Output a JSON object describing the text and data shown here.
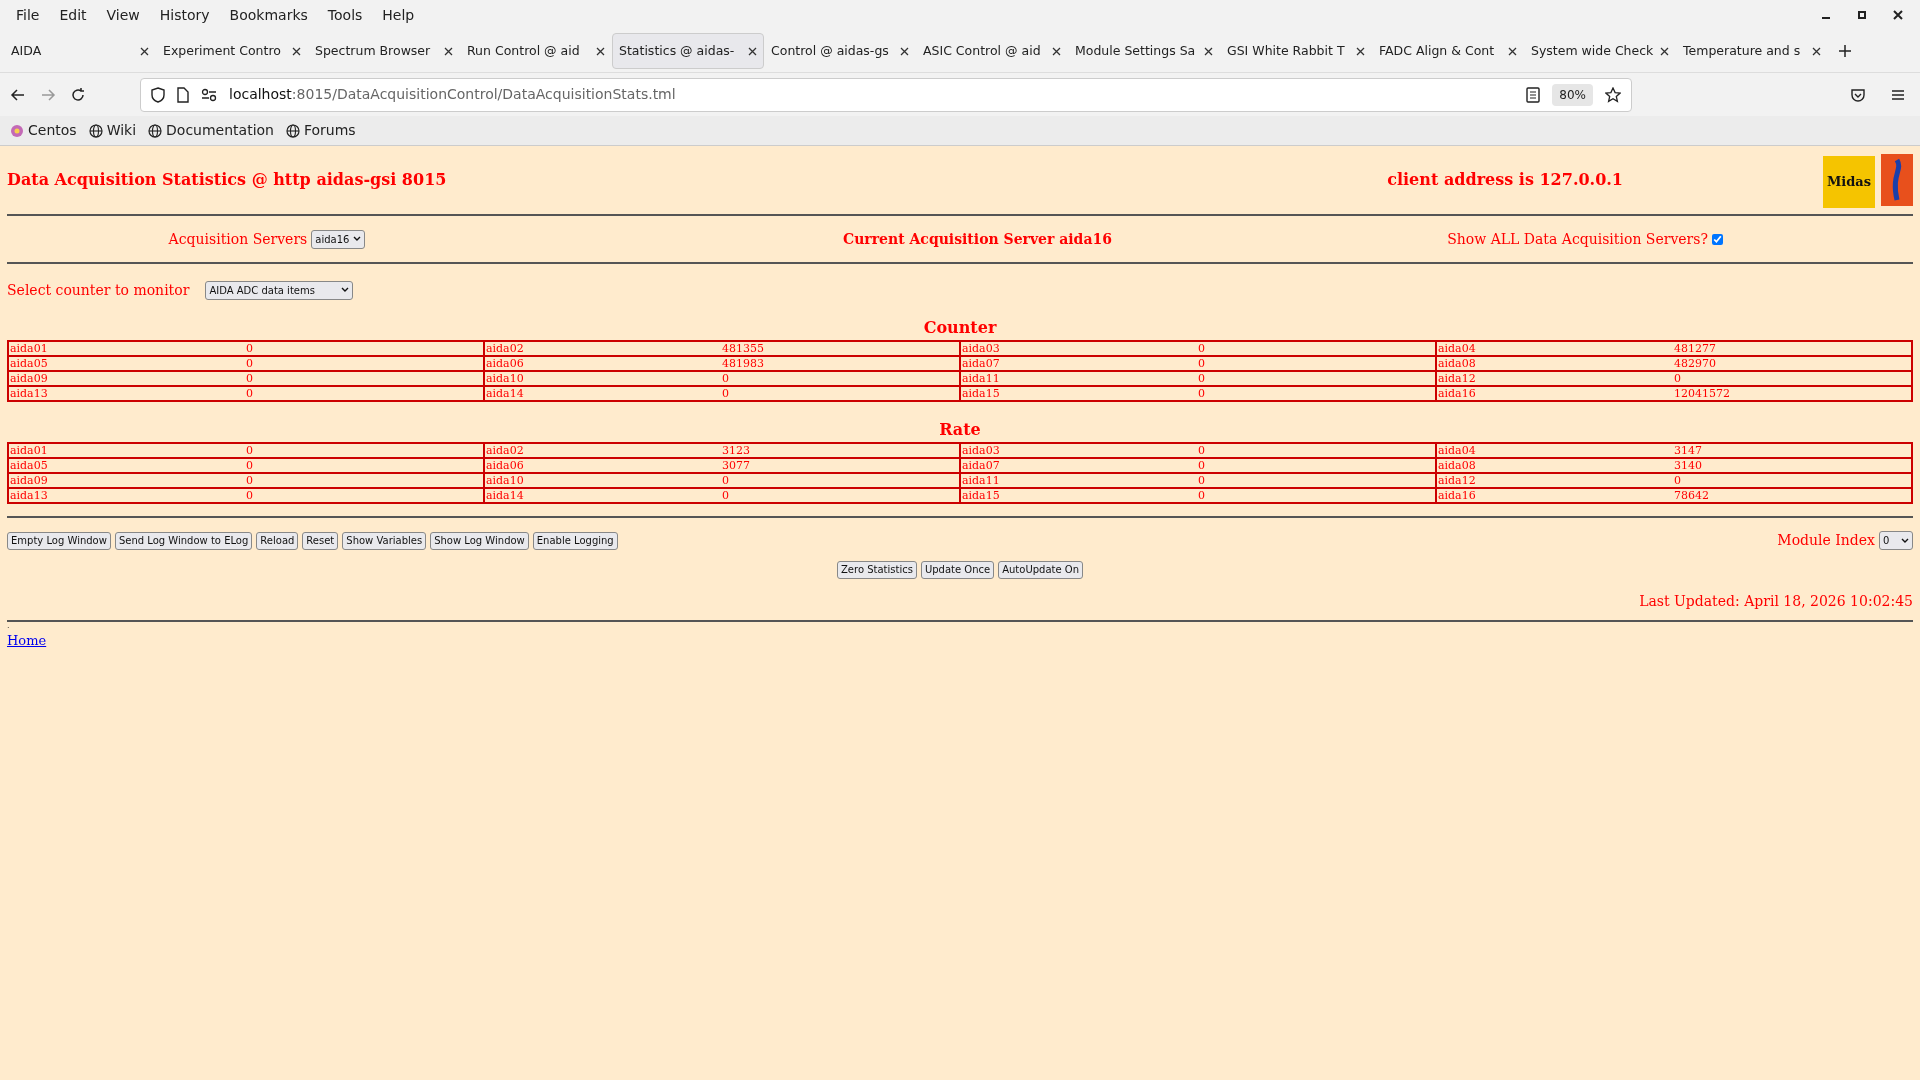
{
  "menu": [
    "File",
    "Edit",
    "View",
    "History",
    "Bookmarks",
    "Tools",
    "Help"
  ],
  "tabs": [
    {
      "label": "AIDA",
      "selected": false
    },
    {
      "label": "Experiment Contro",
      "selected": false
    },
    {
      "label": "Spectrum Browser",
      "selected": false
    },
    {
      "label": "Run Control @ aid",
      "selected": false
    },
    {
      "label": "Statistics @ aidas-",
      "selected": true
    },
    {
      "label": "Control @ aidas-gs",
      "selected": false
    },
    {
      "label": "ASIC Control @ aid",
      "selected": false
    },
    {
      "label": "Module Settings Sa",
      "selected": false
    },
    {
      "label": "GSI White Rabbit T",
      "selected": false
    },
    {
      "label": "FADC Align & Cont",
      "selected": false
    },
    {
      "label": "System wide Check",
      "selected": false
    },
    {
      "label": "Temperature and s",
      "selected": false
    }
  ],
  "address": {
    "host": "localhost",
    "rest": ":8015/DataAcquisitionControl/DataAcquisitionStats.tml",
    "zoom": "80%"
  },
  "bookmarks": [
    {
      "label": "Centos",
      "kind": "centos"
    },
    {
      "label": "Wiki",
      "kind": "globe"
    },
    {
      "label": "Documentation",
      "kind": "globe"
    },
    {
      "label": "Forums",
      "kind": "globe"
    }
  ],
  "page": {
    "title": "Data Acquisition Statistics @ http aidas-gsi 8015",
    "client": "client address is 127.0.0.1",
    "servers_label": "Acquisition Servers",
    "servers_value": "aida16",
    "current_server": "Current Acquisition Server aida16",
    "show_all_label": "Show ALL Data Acquisition Servers?",
    "show_all_checked": true,
    "counter_label": "Select counter to monitor",
    "counter_value": "AIDA ADC data items",
    "tables": [
      {
        "heading": "Counter",
        "rows": [
          [
            [
              "aida01",
              "0"
            ],
            [
              "aida02",
              "481355"
            ],
            [
              "aida03",
              "0"
            ],
            [
              "aida04",
              "481277"
            ]
          ],
          [
            [
              "aida05",
              "0"
            ],
            [
              "aida06",
              "481983"
            ],
            [
              "aida07",
              "0"
            ],
            [
              "aida08",
              "482970"
            ]
          ],
          [
            [
              "aida09",
              "0"
            ],
            [
              "aida10",
              "0"
            ],
            [
              "aida11",
              "0"
            ],
            [
              "aida12",
              "0"
            ]
          ],
          [
            [
              "aida13",
              "0"
            ],
            [
              "aida14",
              "0"
            ],
            [
              "aida15",
              "0"
            ],
            [
              "aida16",
              "12041572"
            ]
          ]
        ]
      },
      {
        "heading": "Rate",
        "rows": [
          [
            [
              "aida01",
              "0"
            ],
            [
              "aida02",
              "3123"
            ],
            [
              "aida03",
              "0"
            ],
            [
              "aida04",
              "3147"
            ]
          ],
          [
            [
              "aida05",
              "0"
            ],
            [
              "aida06",
              "3077"
            ],
            [
              "aida07",
              "0"
            ],
            [
              "aida08",
              "3140"
            ]
          ],
          [
            [
              "aida09",
              "0"
            ],
            [
              "aida10",
              "0"
            ],
            [
              "aida11",
              "0"
            ],
            [
              "aida12",
              "0"
            ]
          ],
          [
            [
              "aida13",
              "0"
            ],
            [
              "aida14",
              "0"
            ],
            [
              "aida15",
              "0"
            ],
            [
              "aida16",
              "78642"
            ]
          ]
        ]
      }
    ],
    "log_buttons": [
      "Empty Log Window",
      "Send Log Window to ELog",
      "Reload",
      "Reset",
      "Show Variables",
      "Show Log Window",
      "Enable Logging"
    ],
    "module_label": "Module Index",
    "module_value": "0",
    "stat_buttons": [
      "Zero Statistics",
      "Update Once",
      "AutoUpdate On"
    ],
    "last_updated": "Last Updated: April 18, 2026 10:02:45",
    "dot": ".",
    "home_link": "Home",
    "logo_text": "Midas"
  }
}
